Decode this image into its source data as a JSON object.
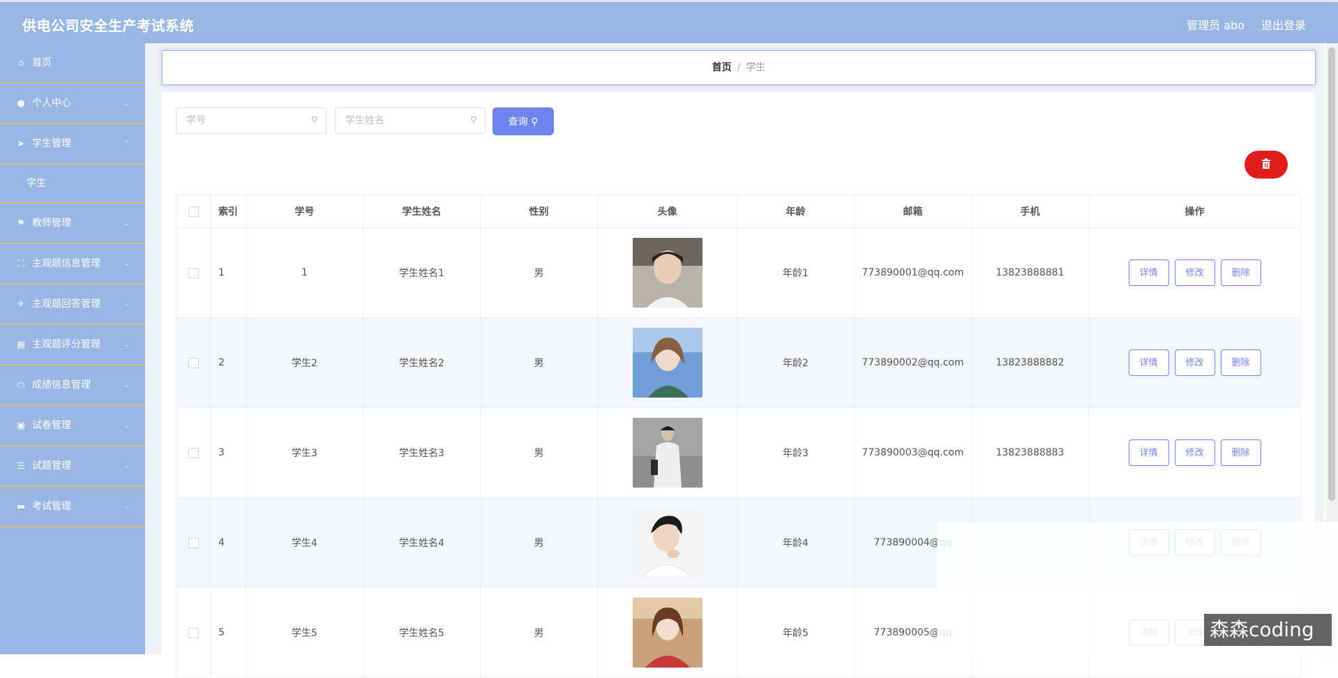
{
  "header": {
    "app_title": "供电公司安全生产考试系统",
    "user": "管理员 abo",
    "logout": "退出登录"
  },
  "sidebar": {
    "items": [
      {
        "label": "首页",
        "icon": "home-icon"
      },
      {
        "label": "个人中心",
        "icon": "user-icon"
      },
      {
        "label": "学生管理",
        "icon": "send-icon"
      },
      {
        "label": "学生",
        "sub": true
      },
      {
        "label": "教师管理",
        "icon": "flag-icon"
      },
      {
        "label": "主观题信息管理",
        "icon": "fullscreen-icon"
      },
      {
        "label": "主观题回答管理",
        "icon": "paper-plane-icon"
      },
      {
        "label": "主观题评分管理",
        "icon": "grid-icon"
      },
      {
        "label": "成绩信息管理",
        "icon": "power-icon"
      },
      {
        "label": "试卷管理",
        "icon": "clipboard-icon"
      },
      {
        "label": "试题管理",
        "icon": "list-icon"
      },
      {
        "label": "考试管理",
        "icon": "briefcase-icon"
      }
    ]
  },
  "breadcrumb": {
    "home": "首页",
    "separator": "/",
    "current": "学生"
  },
  "search": {
    "id_placeholder": "学号",
    "name_placeholder": "学生姓名",
    "query_label": "查询"
  },
  "table": {
    "headers": [
      "索引",
      "学号",
      "学生姓名",
      "性别",
      "头像",
      "年龄",
      "邮箱",
      "手机",
      "操作"
    ],
    "actions": {
      "detail": "详情",
      "edit": "修改",
      "delete": "删除"
    },
    "rows": [
      {
        "index": "1",
        "id": "1",
        "name": "学生姓名1",
        "gender": "男",
        "age": "年龄1",
        "email": "773890001@qq.com",
        "phone": "13823888881"
      },
      {
        "index": "2",
        "id": "学生2",
        "name": "学生姓名2",
        "gender": "男",
        "age": "年龄2",
        "email": "773890002@qq.com",
        "phone": "13823888882"
      },
      {
        "index": "3",
        "id": "学生3",
        "name": "学生姓名3",
        "gender": "男",
        "age": "年龄3",
        "email": "773890003@qq.com",
        "phone": "13823888883"
      },
      {
        "index": "4",
        "id": "学生4",
        "name": "学生姓名4",
        "gender": "男",
        "age": "年龄4",
        "email": "773890004@qq",
        "phone": ""
      },
      {
        "index": "5",
        "id": "学生5",
        "name": "学生姓名5",
        "gender": "男",
        "age": "年龄5",
        "email": "773890005@qq",
        "phone": ""
      }
    ]
  },
  "watermark": "森森coding",
  "colors": {
    "header_bg": "#97b6e3",
    "accent": "#6f83f0",
    "danger": "#e01c1c",
    "menu_divider": "#d9b787"
  }
}
